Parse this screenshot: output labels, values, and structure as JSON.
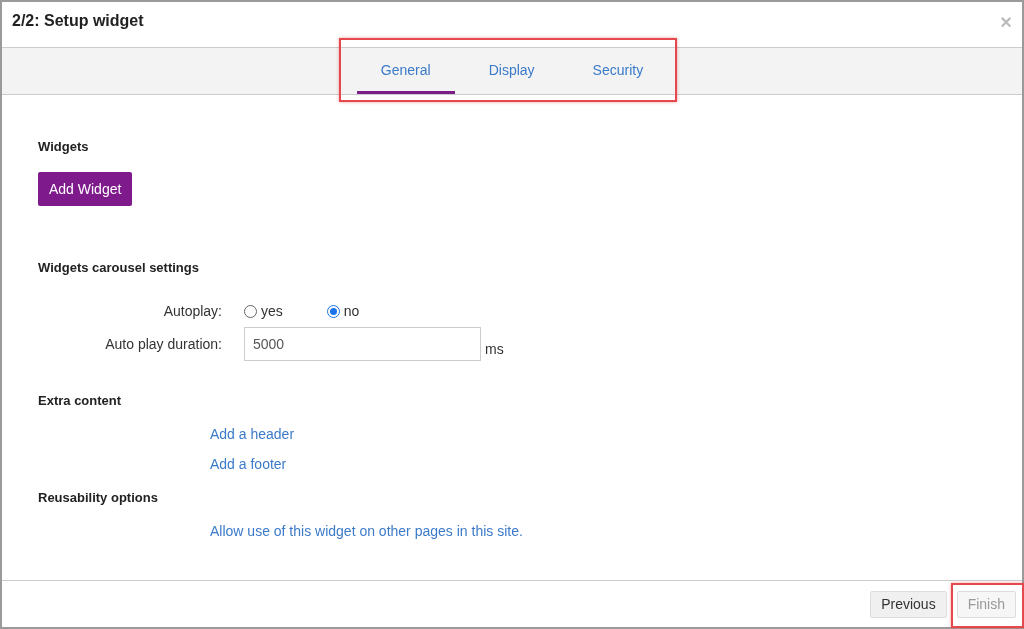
{
  "dialog": {
    "title": "2/2: Setup widget",
    "close": "×"
  },
  "tabs": {
    "highlighted": true,
    "items": [
      {
        "label": "General",
        "selected": true
      },
      {
        "label": "Display",
        "selected": false
      },
      {
        "label": "Security",
        "selected": false
      }
    ]
  },
  "widgets": {
    "heading": "Widgets",
    "button": "Add Widget"
  },
  "carousel": {
    "heading": "Widgets carousel settings",
    "autoplay_label": "Autoplay:",
    "options": [
      {
        "label": "yes",
        "selected": false
      },
      {
        "label": "no",
        "selected": true
      }
    ],
    "duration_label": "Auto play duration:",
    "duration_value": "5000",
    "unit": "ms"
  },
  "extra": {
    "heading": "Extra content",
    "links": [
      "Add a header",
      "Add a footer"
    ]
  },
  "reusability": {
    "heading": "Reusability options",
    "link": "Allow use of this widget on other pages in this site."
  },
  "footer": {
    "buttons": [
      {
        "label": "Previous",
        "disabled": false,
        "highlighted": false
      },
      {
        "label": "Finish",
        "disabled": true,
        "highlighted": true
      }
    ]
  }
}
